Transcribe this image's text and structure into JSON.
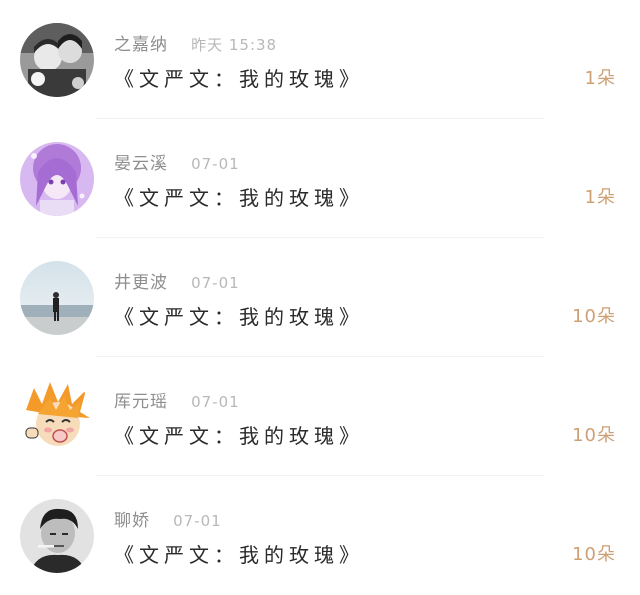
{
  "items": [
    {
      "name": "之嘉纳",
      "time": "昨天 15:38",
      "title": "《文严文：我的玫瑰》",
      "count": "1朵",
      "avatar_icon": "avatar-anime-couple-icon"
    },
    {
      "name": "晏云溪",
      "time": "07-01",
      "title": "《文严文：我的玫瑰》",
      "count": "1朵",
      "avatar_icon": "avatar-purple-hair-girl-icon"
    },
    {
      "name": "井更波",
      "time": "07-01",
      "title": "《文严文：我的玫瑰》",
      "count": "10朵",
      "avatar_icon": "avatar-man-at-sea-icon"
    },
    {
      "name": "厍元瑶",
      "time": "07-01",
      "title": "《文严文：我的玫瑰》",
      "count": "10朵",
      "avatar_icon": "avatar-cartoon-boy-icon"
    },
    {
      "name": "聊娇",
      "time": "07-01",
      "title": "《文严文：我的玫瑰》",
      "count": "10朵",
      "avatar_icon": "avatar-bw-portrait-icon"
    }
  ],
  "colors": {
    "name": "#8e8e8e",
    "time": "#b8b8b8",
    "title": "#2a2a2a",
    "count": "#cfa074",
    "divider": "#f2f2f2"
  }
}
